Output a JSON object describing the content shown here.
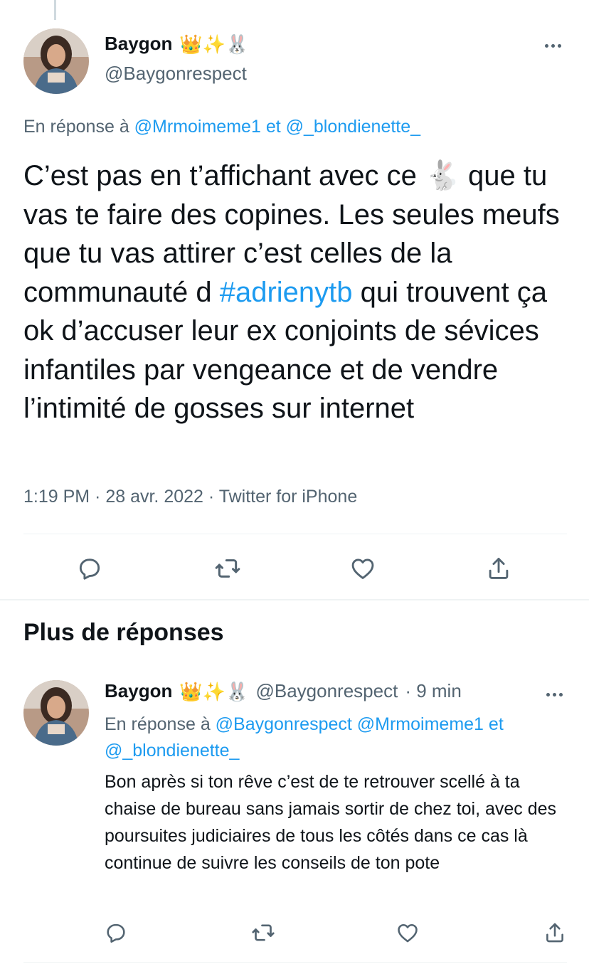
{
  "tweet": {
    "author": {
      "name": "Baygon",
      "emojis": "👑✨🐰",
      "handle": "@Baygonrespect"
    },
    "reply_prefix": "En réponse à",
    "reply_user1": "@Mrmoimeme1",
    "reply_conj": "et",
    "reply_user2": "@_blondienette_",
    "text_before": "C’est pas en t’affichant avec ce",
    "text_emoji": "🐇",
    "text_middle": "que tu vas te faire des copines. Les seules meufs que tu vas attirer c’est celles de la communauté d",
    "hashtag": "#adrienytb",
    "text_after": "qui trouvent ça ok d’accuser leur ex conjoints de sévices infantiles par vengeance et de vendre l’intimité de gosses sur internet",
    "meta": "1:19 PM · 28 avr. 2022 · Twitter for iPhone"
  },
  "section": {
    "title": "Plus de réponses"
  },
  "reply": {
    "author": {
      "name": "Baygon",
      "emojis": "👑✨🐰",
      "handle": "@Baygonrespect",
      "time": "· 9 min"
    },
    "reply_prefix": "En réponse à",
    "reply_user1": "@Baygonrespect",
    "reply_user2": "@Mrmoimeme1",
    "reply_conj": "et",
    "reply_user3": "@_blondienette_",
    "text": "Bon après si ton rêve c’est de te retrouver scellé à ta chaise de bureau sans jamais sortir de chez toi, avec des poursuites judiciaires de tous les côtés dans ce cas là continue de suivre les conseils de ton pote"
  },
  "icons": {
    "reply": "comment-icon",
    "retweet": "retweet-icon",
    "like": "heart-icon",
    "share": "share-icon",
    "more": "more-icon"
  },
  "colors": {
    "accent": "#1d9bf0",
    "secondary_text": "#536471",
    "divider": "#eff3f4"
  }
}
